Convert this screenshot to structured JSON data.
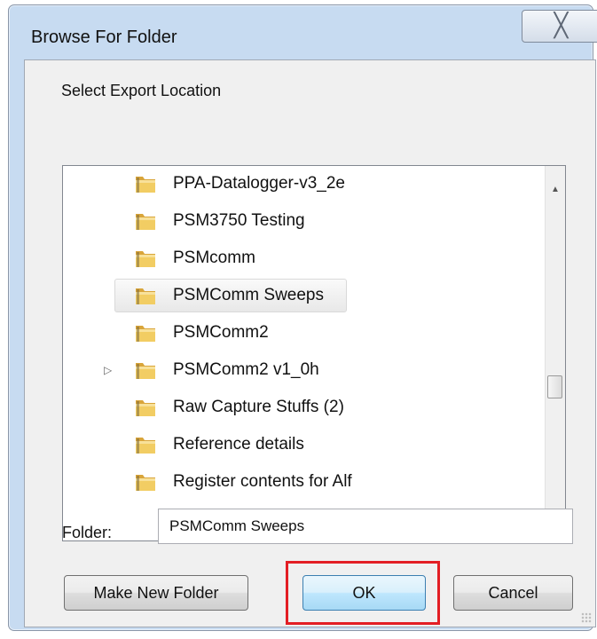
{
  "window": {
    "title": "Browse For Folder",
    "close_glyph": "╳"
  },
  "dialog": {
    "prompt": "Select Export Location",
    "tree": {
      "items": [
        {
          "label": "PPA-Datalogger-v3_2e",
          "selected": false,
          "expandable": false
        },
        {
          "label": "PSM3750 Testing",
          "selected": false,
          "expandable": false
        },
        {
          "label": "PSMcomm",
          "selected": false,
          "expandable": false
        },
        {
          "label": "PSMComm Sweeps",
          "selected": true,
          "expandable": false
        },
        {
          "label": "PSMComm2",
          "selected": false,
          "expandable": false
        },
        {
          "label": "PSMComm2 v1_0h",
          "selected": false,
          "expandable": true
        },
        {
          "label": "Raw Capture Stuffs (2)",
          "selected": false,
          "expandable": false
        },
        {
          "label": "Reference details",
          "selected": false,
          "expandable": false
        },
        {
          "label": "Register contents for Alf",
          "selected": false,
          "expandable": false
        }
      ],
      "folder_icon": "folder-icon",
      "expand_glyph": "▷",
      "scroll_up_glyph": "▲",
      "scroll_down_glyph": "▼"
    },
    "folder_field": {
      "label": "Folder:",
      "value": "PSMComm Sweeps"
    },
    "buttons": {
      "make_new_folder": "Make New Folder",
      "ok": "OK",
      "cancel": "Cancel"
    }
  },
  "colors": {
    "highlight": "#e31e24",
    "window_frame": "#c7dbf1",
    "ok_button": "#bee6fd"
  }
}
